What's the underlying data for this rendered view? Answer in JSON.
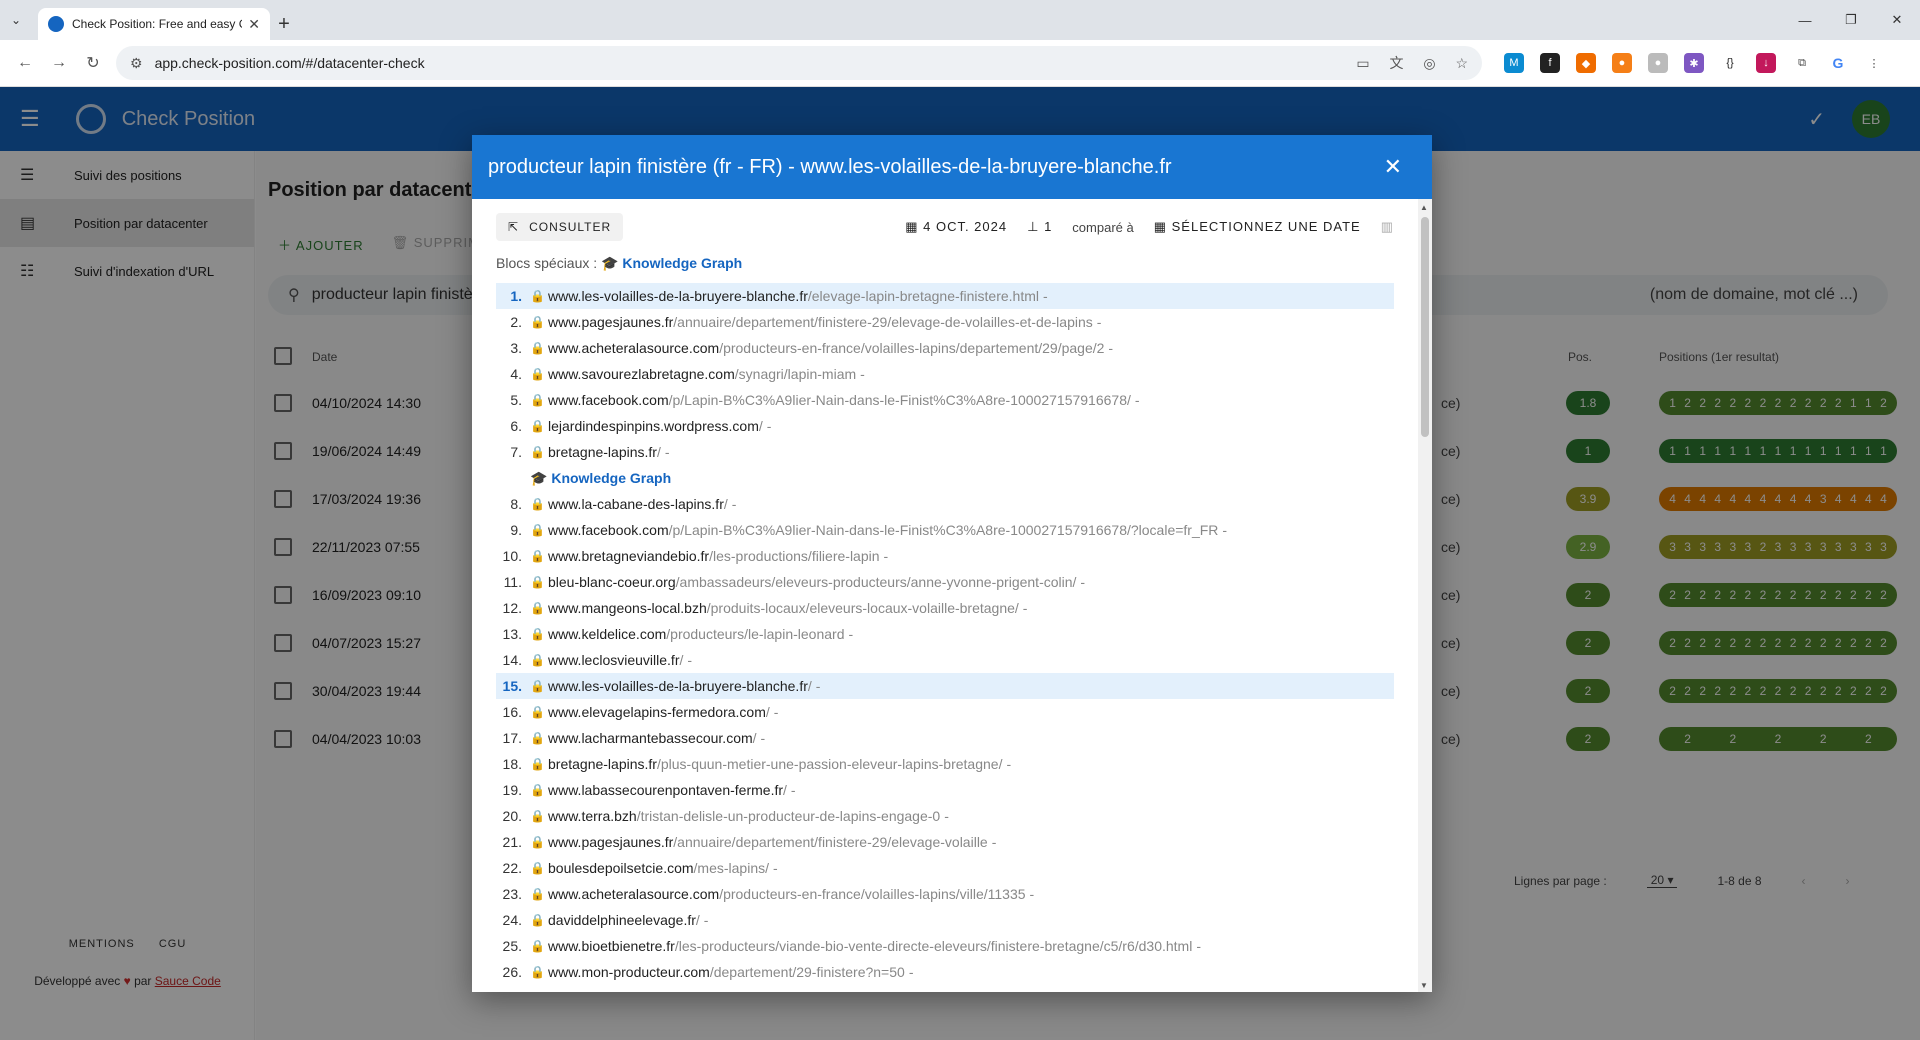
{
  "browser": {
    "tab_title": "Check Position: Free and easy G",
    "url": "app.check-position.com/#/datacenter-check"
  },
  "app": {
    "brand": "Check Position",
    "avatar": "EB",
    "sidebar": [
      {
        "label": "Suivi des positions"
      },
      {
        "label": "Position par datacenter"
      },
      {
        "label": "Suivi d'indexation d'URL"
      }
    ],
    "footer_links": [
      "MENTIONS",
      "CGU"
    ],
    "developed_by": "Développé avec",
    "developed_par": "par",
    "developed_link": "Sauce Code",
    "page_title": "Position par datacenter",
    "add_label": "AJOUTER",
    "delete_label": "SUPPRIMER",
    "search_value": "producteur lapin finistère",
    "search_hint": "(nom de domaine, mot clé ...)",
    "table": {
      "col_date": "Date",
      "col_pos": "Pos.",
      "col_positions": "Positions (1er resultat)",
      "rows": [
        {
          "date": "04/10/2024 14:30",
          "suffix": "ce)",
          "pos": "1.8",
          "pos_color": "#2e7d32",
          "strip": [
            "1",
            "2",
            "2",
            "2",
            "2",
            "2",
            "2",
            "2",
            "2",
            "2",
            "2",
            "2",
            "1",
            "1",
            "2"
          ],
          "strip_color": "#558b2f"
        },
        {
          "date": "19/06/2024 14:49",
          "suffix": "ce)",
          "pos": "1",
          "pos_color": "#2e7d32",
          "strip": [
            "1",
            "1",
            "1",
            "1",
            "1",
            "1",
            "1",
            "1",
            "1",
            "1",
            "1",
            "1",
            "1",
            "1",
            "1"
          ],
          "strip_color": "#2e7d32"
        },
        {
          "date": "17/03/2024 19:36",
          "suffix": "ce)",
          "pos": "3.9",
          "pos_color": "#9e9d24",
          "strip": [
            "4",
            "4",
            "4",
            "4",
            "4",
            "4",
            "4",
            "4",
            "4",
            "4",
            "3",
            "4",
            "4",
            "4",
            "4"
          ],
          "strip_color": "#e07b00"
        },
        {
          "date": "22/11/2023 07:55",
          "suffix": "ce)",
          "pos": "2.9",
          "pos_color": "#7cb342",
          "strip": [
            "3",
            "3",
            "3",
            "3",
            "3",
            "3",
            "2",
            "3",
            "3",
            "3",
            "3",
            "3",
            "3",
            "3",
            "3"
          ],
          "strip_color": "#9e9d24"
        },
        {
          "date": "16/09/2023 09:10",
          "suffix": "ce)",
          "pos": "2",
          "pos_color": "#558b2f",
          "strip": [
            "2",
            "2",
            "2",
            "2",
            "2",
            "2",
            "2",
            "2",
            "2",
            "2",
            "2",
            "2",
            "2",
            "2",
            "2"
          ],
          "strip_color": "#558b2f"
        },
        {
          "date": "04/07/2023 15:27",
          "suffix": "ce)",
          "pos": "2",
          "pos_color": "#558b2f",
          "strip": [
            "2",
            "2",
            "2",
            "2",
            "2",
            "2",
            "2",
            "2",
            "2",
            "2",
            "2",
            "2",
            "2",
            "2",
            "2"
          ],
          "strip_color": "#558b2f"
        },
        {
          "date": "30/04/2023 19:44",
          "suffix": "ce)",
          "pos": "2",
          "pos_color": "#558b2f",
          "strip": [
            "2",
            "2",
            "2",
            "2",
            "2",
            "2",
            "2",
            "2",
            "2",
            "2",
            "2",
            "2",
            "2",
            "2",
            "2"
          ],
          "strip_color": "#558b2f"
        },
        {
          "date": "04/04/2023 10:03",
          "suffix": "ce)",
          "pos": "2",
          "pos_color": "#558b2f",
          "strip": [
            "2",
            "2",
            "2",
            "2",
            "2"
          ],
          "strip_color": "#558b2f"
        }
      ]
    },
    "pager": {
      "label": "Lignes par page :",
      "per_page": "20",
      "range": "1-8 de 8"
    }
  },
  "dialog": {
    "title": "producteur lapin finistère (fr - FR) - www.les-volailles-de-la-bruyere-blanche.fr",
    "consult": "CONSULTER",
    "date": "4 OCT. 2024",
    "dc_count": "1",
    "compare": "comparé à",
    "select_date": "SÉLECTIONNEZ UNE DATE",
    "specials_label": "Blocs spéciaux :",
    "knowledge_graph": "Knowledge Graph",
    "results": [
      {
        "n": "1.",
        "dom": "www.les-volailles-de-la-bruyere-blanche.fr",
        "path": "/elevage-lapin-bretagne-finistere.html",
        "hl": true
      },
      {
        "n": "2.",
        "dom": "www.pagesjaunes.fr",
        "path": "/annuaire/departement/finistere-29/elevage-de-volailles-et-de-lapins"
      },
      {
        "n": "3.",
        "dom": "www.acheteralasource.com",
        "path": "/producteurs-en-france/volailles-lapins/departement/29/page/2"
      },
      {
        "n": "4.",
        "dom": "www.savourezlabretagne.com",
        "path": "/synagri/lapin-miam"
      },
      {
        "n": "5.",
        "dom": "www.facebook.com",
        "path": "/p/Lapin-B%C3%A9lier-Nain-dans-le-Finist%C3%A8re-100027157916678/"
      },
      {
        "n": "6.",
        "dom": "lejardindespinpins.wordpress.com",
        "path": "/"
      },
      {
        "n": "7.",
        "dom": "bretagne-lapins.fr",
        "path": "/"
      },
      {
        "kg": true
      },
      {
        "n": "8.",
        "dom": "www.la-cabane-des-lapins.fr",
        "path": "/"
      },
      {
        "n": "9.",
        "dom": "www.facebook.com",
        "path": "/p/Lapin-B%C3%A9lier-Nain-dans-le-Finist%C3%A8re-100027157916678/?locale=fr_FR"
      },
      {
        "n": "10.",
        "dom": "www.bretagneviandebio.fr",
        "path": "/les-productions/filiere-lapin"
      },
      {
        "n": "11.",
        "dom": "bleu-blanc-coeur.org",
        "path": "/ambassadeurs/eleveurs-producteurs/anne-yvonne-prigent-colin/"
      },
      {
        "n": "12.",
        "dom": "www.mangeons-local.bzh",
        "path": "/produits-locaux/eleveurs-locaux-volaille-bretagne/"
      },
      {
        "n": "13.",
        "dom": "www.keldelice.com",
        "path": "/producteurs/le-lapin-leonard"
      },
      {
        "n": "14.",
        "dom": "www.leclosvieuville.fr",
        "path": "/"
      },
      {
        "n": "15.",
        "dom": "www.les-volailles-de-la-bruyere-blanche.fr",
        "path": "/",
        "hl": true
      },
      {
        "n": "16.",
        "dom": "www.elevagelapins-fermedora.com",
        "path": "/"
      },
      {
        "n": "17.",
        "dom": "www.lacharmantebassecour.com",
        "path": "/"
      },
      {
        "n": "18.",
        "dom": "bretagne-lapins.fr",
        "path": "/plus-quun-metier-une-passion-eleveur-lapins-bretagne/"
      },
      {
        "n": "19.",
        "dom": "www.labassecourenpontaven-ferme.fr",
        "path": "/"
      },
      {
        "n": "20.",
        "dom": "www.terra.bzh",
        "path": "/tristan-delisle-un-producteur-de-lapins-engage-0"
      },
      {
        "n": "21.",
        "dom": "www.pagesjaunes.fr",
        "path": "/annuaire/departement/finistere-29/elevage-volaille"
      },
      {
        "n": "22.",
        "dom": "boulesdepoilsetcie.com",
        "path": "/mes-lapins/"
      },
      {
        "n": "23.",
        "dom": "www.acheteralasource.com",
        "path": "/producteurs-en-france/volailles-lapins/ville/11335"
      },
      {
        "n": "24.",
        "dom": "daviddelphineelevage.fr",
        "path": "/"
      },
      {
        "n": "25.",
        "dom": "www.bioetbienetre.fr",
        "path": "/les-producteurs/viande-bio-vente-directe-eleveurs/finistere-bretagne/c5/r6/d30.html"
      },
      {
        "n": "26.",
        "dom": "www.mon-producteur.com",
        "path": "/departement/29-finistere?n=50"
      }
    ]
  }
}
